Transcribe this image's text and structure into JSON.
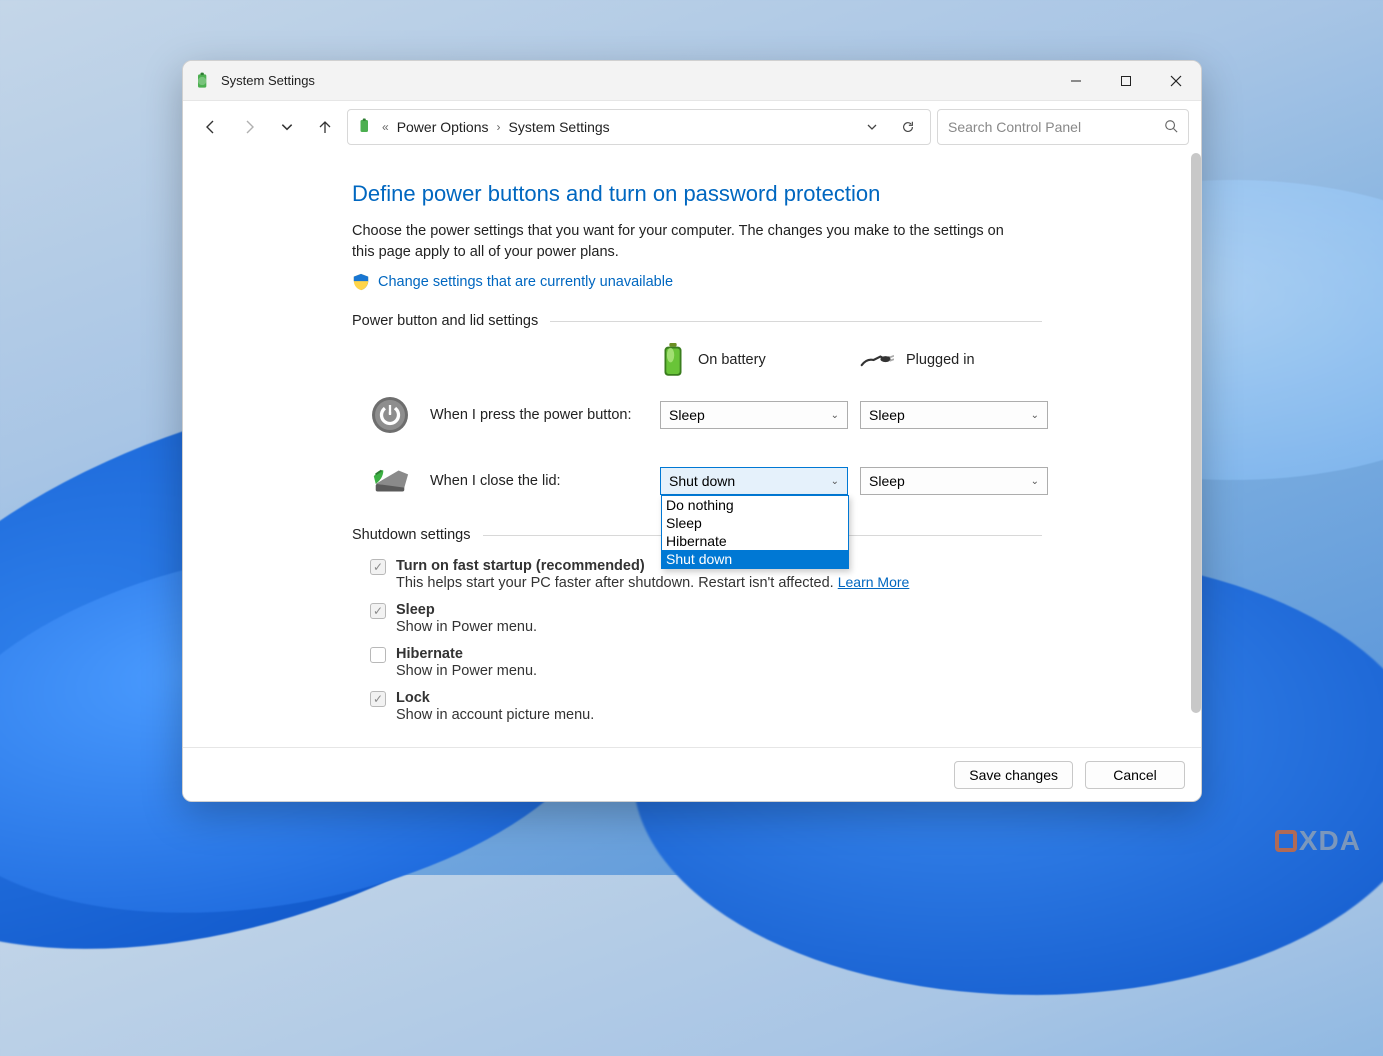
{
  "titlebar": {
    "title": "System Settings"
  },
  "breadcrumbs": {
    "root_marker": "«",
    "level1": "Power Options",
    "level2": "System Settings"
  },
  "search": {
    "placeholder": "Search Control Panel"
  },
  "page": {
    "heading": "Define power buttons and turn on password protection",
    "description": "Choose the power settings that you want for your computer. The changes you make to the settings on this page apply to all of your power plans.",
    "admin_link": "Change settings that are currently unavailable"
  },
  "group1": {
    "legend": "Power button and lid settings",
    "col_battery": "On battery",
    "col_plugged": "Plugged in",
    "row_power_label": "When I press the power button:",
    "row_power_battery": "Sleep",
    "row_power_plugged": "Sleep",
    "row_lid_label": "When I close the lid:",
    "row_lid_battery": "Shut down",
    "row_lid_plugged": "Sleep",
    "dropdown_options": {
      "o1": "Do nothing",
      "o2": "Sleep",
      "o3": "Hibernate",
      "o4": "Shut down"
    }
  },
  "group2": {
    "legend": "Shutdown settings",
    "fast_startup_label": "Turn on fast startup (recommended)",
    "fast_startup_sub": "This helps start your PC faster after shutdown. Restart isn't affected. ",
    "fast_startup_link": "Learn More",
    "sleep_label": "Sleep",
    "sleep_sub": "Show in Power menu.",
    "hibernate_label": "Hibernate",
    "hibernate_sub": "Show in Power menu.",
    "lock_label": "Lock",
    "lock_sub": "Show in account picture menu."
  },
  "footer": {
    "save": "Save changes",
    "cancel": "Cancel"
  },
  "watermark": "XDA"
}
